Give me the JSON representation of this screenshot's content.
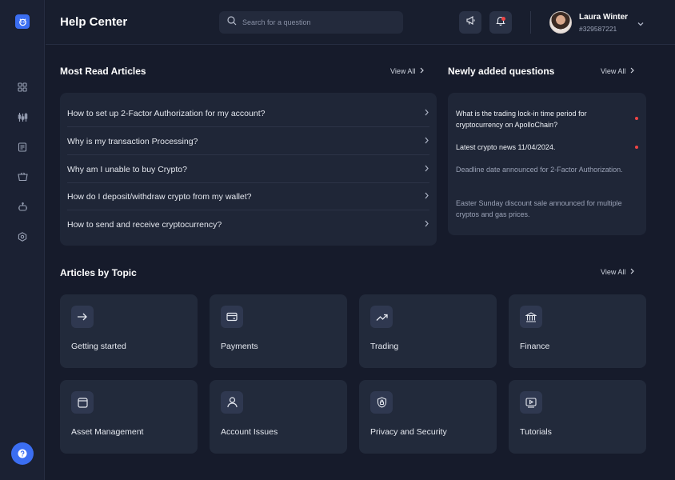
{
  "header": {
    "title": "Help Center",
    "search_placeholder": "Search for a question",
    "user": {
      "name": "Laura Winter",
      "id": "#329587221"
    }
  },
  "most_read": {
    "title": "Most Read Articles",
    "view_all": "View All",
    "articles": [
      "How to set up 2-Factor Authorization for my account?",
      "Why is my transaction Processing?",
      "Why am I unable to buy Crypto?",
      "How do I deposit/withdraw crypto from my wallet?",
      "How to send and receive cryptocurrency?"
    ]
  },
  "newly_added": {
    "title": "Newly added questions",
    "view_all": "View All",
    "questions": [
      {
        "text": "What is the trading lock-in time period for cryptocurrency on ApolloChain?",
        "unread": true
      },
      {
        "text": "Latest crypto news 11/04/2024.",
        "unread": true
      },
      {
        "text": "Deadline date announced for 2-Factor Authorization.",
        "unread": false
      },
      {
        "text": "Easter Sunday discount sale announced for multiple cryptos and gas prices.",
        "unread": false
      }
    ]
  },
  "topics": {
    "title": "Articles by Topic",
    "view_all": "View All",
    "items": [
      {
        "label": "Getting started",
        "icon": "arrow-right-icon"
      },
      {
        "label": "Payments",
        "icon": "card-icon"
      },
      {
        "label": "Trading",
        "icon": "trend-up-icon"
      },
      {
        "label": "Finance",
        "icon": "bank-icon"
      },
      {
        "label": "Asset Management",
        "icon": "window-icon"
      },
      {
        "label": "Account Issues",
        "icon": "user-icon"
      },
      {
        "label": "Privacy and Security",
        "icon": "shield-lock-icon"
      },
      {
        "label": "Tutorials",
        "icon": "video-icon"
      }
    ]
  },
  "colors": {
    "accent": "#3b6ef2",
    "alert": "#ef4444",
    "background": "#161b2b"
  }
}
